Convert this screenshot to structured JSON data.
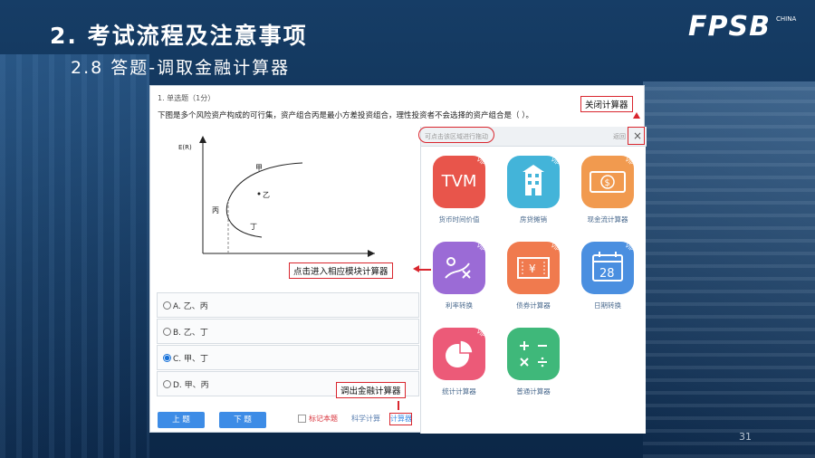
{
  "slide": {
    "title": "2. 考试流程及注意事项",
    "subtitle": "2.8 答题-调取金融计算器",
    "page_number": "31",
    "logo": "FPSB",
    "logo_sub": "CHINA"
  },
  "question": {
    "header": "1. 单选题（1分）",
    "text": "下图是多个风险资产构成的可行集，资产组合丙是最小方差投资组合，理性投资者不会选择的资产组合是（   ）。",
    "graph": {
      "y_label": "E(R)",
      "labels": [
        "甲",
        "乙",
        "丙",
        "丁"
      ]
    },
    "options": [
      {
        "text": "A. 乙、丙",
        "selected": false
      },
      {
        "text": "B. 乙、丁",
        "selected": false
      },
      {
        "text": "C. 甲、丁",
        "selected": true
      },
      {
        "text": "D. 甲、丙",
        "selected": false
      }
    ],
    "prev_button": "上 题",
    "next_button": "下 题",
    "mark_label": "标记本题",
    "tool_link_1": "科学计算",
    "tool_link_2": "计算器"
  },
  "calculator": {
    "search_hint": "可点击该区域进行拖动",
    "back_label": "返回",
    "close_glyph": "×",
    "tiles": [
      {
        "label": "货币时间价值",
        "glyph": "TVM",
        "color": "#e8554b",
        "icon": "tvm-icon"
      },
      {
        "label": "房贷摊销",
        "glyph": "▙",
        "color": "#43b4d9",
        "icon": "building-icon"
      },
      {
        "label": "现金流计算器",
        "glyph": "$",
        "color": "#f19a4f",
        "icon": "cash-flow-icon"
      },
      {
        "label": "利率转换",
        "glyph": "⤳",
        "color": "#9b6bd6",
        "icon": "rate-convert-icon"
      },
      {
        "label": "债券计算器",
        "glyph": "¥",
        "color": "#f07a4e",
        "icon": "bond-ticket-icon"
      },
      {
        "label": "日期转换",
        "glyph": "28",
        "color": "#4a8fe0",
        "icon": "calendar-icon"
      },
      {
        "label": "统计计算器",
        "glyph": "◔",
        "color": "#ec5a78",
        "icon": "pie-chart-icon"
      },
      {
        "label": "普通计算器",
        "glyph": "±",
        "color": "#3fb87a",
        "icon": "basic-calculator-icon"
      }
    ],
    "vip_badge": "VIP"
  },
  "annotations": {
    "close_calc": "关闭计算器",
    "enter_module": "点击进入相应模块计算器",
    "open_calc": "调出金融计算器"
  }
}
